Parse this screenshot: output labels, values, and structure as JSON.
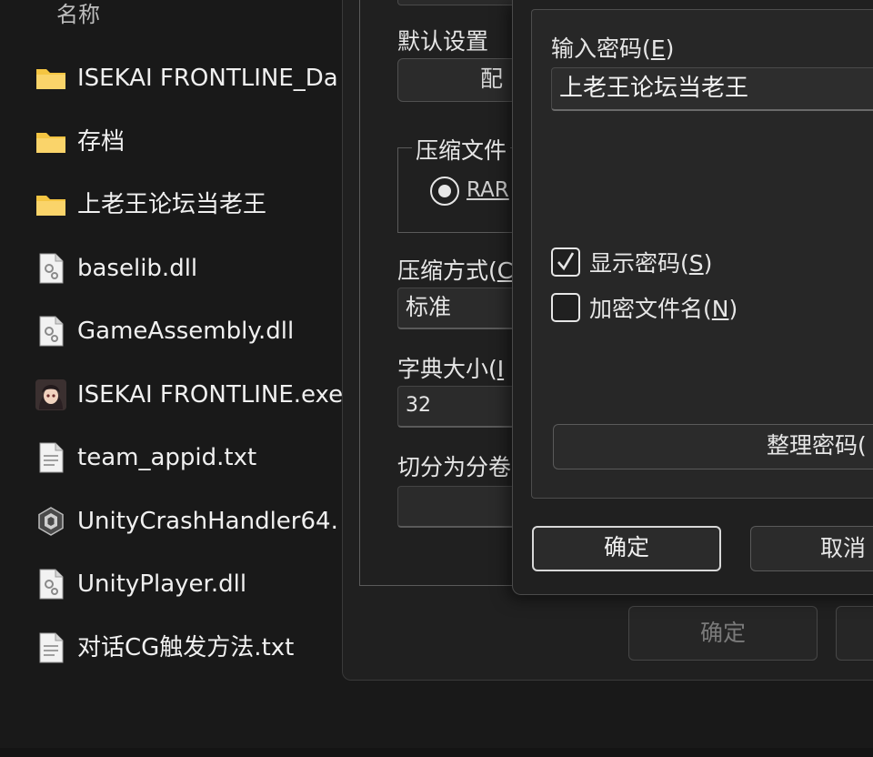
{
  "explorer": {
    "column_header": "名称",
    "files": [
      {
        "name": "ISEKAI FRONTLINE_Da",
        "icon": "folder-icon",
        "kind": "folder"
      },
      {
        "name": "存档",
        "icon": "folder-icon",
        "kind": "folder"
      },
      {
        "name": "上老王论坛当老王",
        "icon": "folder-icon",
        "kind": "folder"
      },
      {
        "name": "baselib.dll",
        "icon": "dll-file-icon",
        "kind": "dll"
      },
      {
        "name": "GameAssembly.dll",
        "icon": "dll-file-icon",
        "kind": "dll"
      },
      {
        "name": "ISEKAI FRONTLINE.exe",
        "icon": "game-exe-icon",
        "kind": "exe"
      },
      {
        "name": "team_appid.txt",
        "icon": "text-file-icon",
        "kind": "txt"
      },
      {
        "name": "UnityCrashHandler64.",
        "icon": "unity-icon",
        "kind": "unity"
      },
      {
        "name": "UnityPlayer.dll",
        "icon": "dll-file-icon",
        "kind": "dll"
      },
      {
        "name": "对话CG触发方法.txt",
        "icon": "text-file-icon",
        "kind": "txt"
      }
    ]
  },
  "archive_dialog": {
    "default_settings_label": "默认设置",
    "config_button": "配",
    "compress_format_group": "压缩文件",
    "format_radio": "RAR",
    "compress_method_label": "压缩方式(",
    "compress_method_mnemonic": "C",
    "compress_method_value": "标准",
    "dictionary_label": "字典大小(",
    "dictionary_mnemonic": "I",
    "dictionary_value": "32",
    "split_label": "切分为分卷",
    "ok_button": "确定"
  },
  "password_dialog": {
    "enter_password_label": "输入密码(",
    "enter_password_mnemonic": "E",
    "label_close": ")",
    "password_value": "上老王论坛当老王",
    "show_password_label": "显示密码(",
    "show_password_mnemonic": "S",
    "show_password_checked": true,
    "encrypt_names_label": "加密文件名(",
    "encrypt_names_mnemonic": "N",
    "encrypt_names_checked": false,
    "manage_button": "整理密码(",
    "ok_button": "确定",
    "cancel_button": "取消"
  },
  "colors": {
    "folder": "#F4C542",
    "background": "#191919",
    "dialog": "#202020"
  }
}
